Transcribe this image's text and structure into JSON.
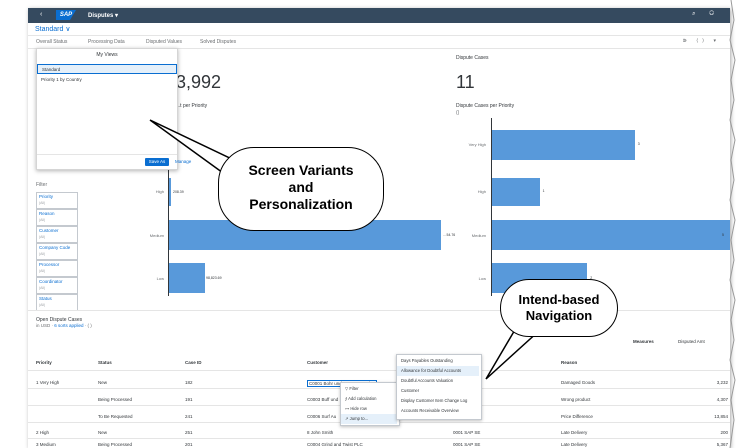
{
  "shell": {
    "back": "‹",
    "logo": "SAP",
    "app_title": "Disputes ▾",
    "icons": "⌕ ⚇"
  },
  "variant": {
    "label": "Standard ∨"
  },
  "tabs": [
    {
      "label": "Overall Status"
    },
    {
      "label": "Processing Data"
    },
    {
      "label": "Disputed Values"
    },
    {
      "label": "Solved Disputes"
    }
  ],
  "tab_tools": "⋑ ⟨⟩ ▾",
  "kpis": [
    {
      "title": "",
      "value": "3,992"
    },
    {
      "title": "Dispute Cases",
      "value": "11"
    }
  ],
  "chart_data": [
    {
      "type": "bar",
      "title": "...t per Priority",
      "subtitle": "",
      "categories": [
        "High",
        "Medium",
        "Low"
      ],
      "values": [
        208.39,
        254.76,
        98823.69
      ],
      "value_labels": [
        "208.39",
        "…54.76",
        "98,823.69"
      ],
      "orientation": "horizontal"
    },
    {
      "type": "bar",
      "title": "Dispute Cases per Priority",
      "subtitle": "()",
      "categories": [
        "Very High",
        "High",
        "Medium",
        "Low"
      ],
      "values": [
        3,
        1,
        5,
        2
      ],
      "orientation": "horizontal"
    }
  ],
  "filter": {
    "label": "Filter",
    "items": [
      {
        "label": "Priority",
        "sub": "(All)"
      },
      {
        "label": "Reason",
        "sub": "(All)"
      },
      {
        "label": "Customer",
        "sub": "(All)"
      },
      {
        "label": "Company Code",
        "sub": "(All)"
      },
      {
        "label": "Processor",
        "sub": "(All)"
      },
      {
        "label": "Coordinator",
        "sub": "(All)"
      },
      {
        "label": "Status",
        "sub": "(All)"
      }
    ]
  },
  "my_views": {
    "title": "My Views",
    "items": [
      "Standard",
      "Priority 1 by Country"
    ],
    "save_as": "Save As",
    "manage": "Manage"
  },
  "callouts": {
    "variants": [
      "Screen Variants",
      "and",
      "Personalization"
    ],
    "navigation": [
      "Intend-based",
      "Navigation"
    ]
  },
  "table": {
    "title": "Open Dispute Cases",
    "subtitle_prefix": "in USD · ",
    "subtitle_link": "6 sorts applied",
    "subtitle_suffix": " · ( )",
    "measures": "Measures",
    "disputed_amount": "Disputed Amt",
    "headers": [
      "Priority",
      "Status",
      "Case ID",
      "Customer",
      "Code",
      "Reason"
    ],
    "rows": [
      {
        "priority": "1 Very High",
        "status": "New",
        "case_id": "182",
        "customer": "C0001 Bohr und Hammer GmbH",
        "code": "SE",
        "reason": "Damaged Goods",
        "amount": "3,232"
      },
      {
        "priority": "",
        "status": "Being Processed",
        "case_id": "191",
        "customer": "C0003 Buff und",
        "code": "SE",
        "reason": "Wrong product",
        "amount": "4,307"
      },
      {
        "priority": "",
        "status": "To Be Requested",
        "case_id": "241",
        "customer": "C0006 Surf Au",
        "code": "SE",
        "reason": "Price Difference",
        "amount": "13,854"
      },
      {
        "priority": "2 High",
        "status": "New",
        "case_id": "251",
        "customer": "8 John Smith",
        "code": "0001 SAP SE",
        "reason": "Late Delivery",
        "amount": "200"
      },
      {
        "priority": "3 Medium",
        "status": "Being Processed",
        "case_id": "201",
        "customer": "C0004 Grind and Twist PLC",
        "code": "0001 SAP SE",
        "reason": "Late Delivery",
        "amount": "5,367"
      }
    ]
  },
  "context_menu": {
    "items": [
      "▽  Filter",
      "∱  Add calculation",
      "⊶  Hide row",
      "↗  Jump to..."
    ]
  },
  "jump_menu": {
    "items": [
      "Days Payables Outstanding",
      "Allowance for Doubtful Accounts",
      "Doubtful Accounts Valuation",
      "Customer",
      "Display Customer Item Change Log",
      "Accounts Receivable Overview"
    ]
  }
}
